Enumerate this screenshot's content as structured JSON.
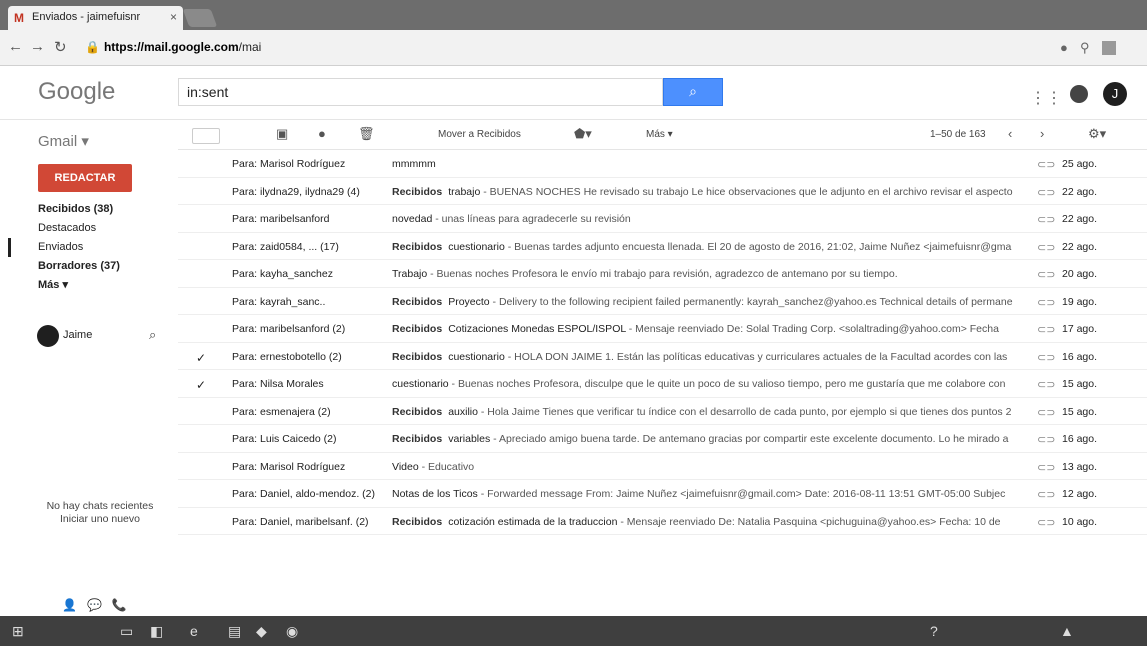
{
  "browser": {
    "tab_title": "Enviados - jaimefuisnr",
    "tab_logo": "M",
    "url_host": "https://mail.google.com",
    "url_path": "/mai",
    "nav_icons": [
      "back-icon",
      "forward-icon",
      "reload-icon"
    ]
  },
  "header": {
    "logo": "Google",
    "search_value": "in:sent"
  },
  "sidebar": {
    "app_label": "Gmail ▾",
    "compose_label": "REDACTAR",
    "items": [
      {
        "label": "Recibidos (38)",
        "bold": true
      },
      {
        "label": "Destacados",
        "bold": false
      },
      {
        "label": "Enviados",
        "bold": false,
        "active": true
      },
      {
        "label": "Borradores (37)",
        "bold": true
      },
      {
        "label": "Más ▾",
        "bold": true
      }
    ],
    "chat_user": "Jaime",
    "no_chats_line1": "No hay chats recientes",
    "no_chats_line2": "Iniciar uno nuevo"
  },
  "toolbar": {
    "move_label": "Mover a Recibidos",
    "more_label": "Más ▾",
    "range": "1–50 de 163"
  },
  "emails": [
    {
      "checked": false,
      "sender": "Para: Marisol Rodríguez",
      "label": "",
      "subject": "mmmmm",
      "snippet": "",
      "date": "25 ago."
    },
    {
      "checked": false,
      "sender": "Para: ilydna29, ilydna29 (4)",
      "label": "Recibidos",
      "subject": "trabajo",
      "snippet": " - BUENAS NOCHES He revisado su trabajo Le hice observaciones que le adjunto en el archivo revisar el aspecto",
      "date": "22 ago."
    },
    {
      "checked": false,
      "sender": "Para: maribelsanford",
      "label": "",
      "subject": "novedad",
      "snippet": " - unas líneas para agradecerle su revisión",
      "date": "22 ago."
    },
    {
      "checked": false,
      "sender": "Para: zaid0584, ... (17)",
      "label": "Recibidos",
      "subject": "cuestionario",
      "snippet": " - Buenas tardes adjunto encuesta llenada. El 20 de agosto de 2016, 21:02, Jaime Nuñez <jaimefuisnr@gma",
      "date": "22 ago."
    },
    {
      "checked": false,
      "sender": "Para: kayha_sanchez",
      "label": "",
      "subject": "Trabajo",
      "snippet": " - Buenas noches Profesora le envío mi trabajo para revisión, agradezco de antemano por su tiempo.",
      "date": "20 ago."
    },
    {
      "checked": false,
      "sender": "Para: kayrah_sanc..",
      "label": "Recibidos",
      "subject": "Proyecto",
      "snippet": " - Delivery to the following recipient failed permanently: kayrah_sanchez@yahoo.es Technical details of permane",
      "date": "19 ago."
    },
    {
      "checked": false,
      "sender": "Para: maribelsanford (2)",
      "label": "Recibidos",
      "subject": "Cotizaciones Monedas ESPOL/ISPOL",
      "snippet": " - Mensaje reenviado De: Solal Trading Corp. <solaltrading@yahoo.com> Fecha",
      "date": "17 ago."
    },
    {
      "checked": true,
      "sender": "Para: ernestobotello (2)",
      "label": "Recibidos",
      "subject": "cuestionario",
      "snippet": " - HOLA DON JAIME 1. Están las políticas educativas y curriculares actuales de la Facultad acordes con las",
      "date": "16 ago."
    },
    {
      "checked": true,
      "sender": "Para: Nilsa Morales",
      "label": "",
      "subject": "cuestionario",
      "snippet": " - Buenas noches Profesora, disculpe que le quite un poco de su valioso tiempo, pero me gustaría que me colabore con",
      "date": "15 ago."
    },
    {
      "checked": false,
      "sender": "Para: esmenajera (2)",
      "label": "Recibidos",
      "subject": "auxilio",
      "snippet": " - Hola Jaime Tienes que verificar tu índice con el desarrollo de cada punto, por ejemplo si que tienes dos puntos 2",
      "date": "15 ago."
    },
    {
      "checked": false,
      "sender": "Para: Luis Caicedo (2)",
      "label": "Recibidos",
      "subject": "variables",
      "snippet": " - Apreciado amigo buena tarde. De antemano gracias por compartir este excelente documento. Lo he mirado a",
      "date": "16 ago."
    },
    {
      "checked": false,
      "sender": "Para: Marisol Rodríguez",
      "label": "",
      "subject": "Video",
      "snippet": " - Educativo",
      "date": "13 ago."
    },
    {
      "checked": false,
      "sender": "Para: Daniel, aldo-mendoz. (2)",
      "label": "",
      "subject": "Notas de los Ticos",
      "snippet": " - Forwarded message From: Jaime Nuñez <jaimefuisnr@gmail.com> Date: 2016-08-11 13:51 GMT-05:00 Subjec",
      "date": "12 ago."
    },
    {
      "checked": false,
      "sender": "Para: Daniel, maribelsanf. (2)",
      "label": "Recibidos",
      "subject": "cotización estimada de la traduccion",
      "snippet": " - Mensaje reenviado De: Natalia Pasquina <pichuguina@yahoo.es> Fecha: 10 de",
      "date": "10 ago."
    }
  ],
  "colors": {
    "compose_bg": "#d14836",
    "search_btn": "#4d90fe",
    "taskbar": "#3f3f3f"
  }
}
